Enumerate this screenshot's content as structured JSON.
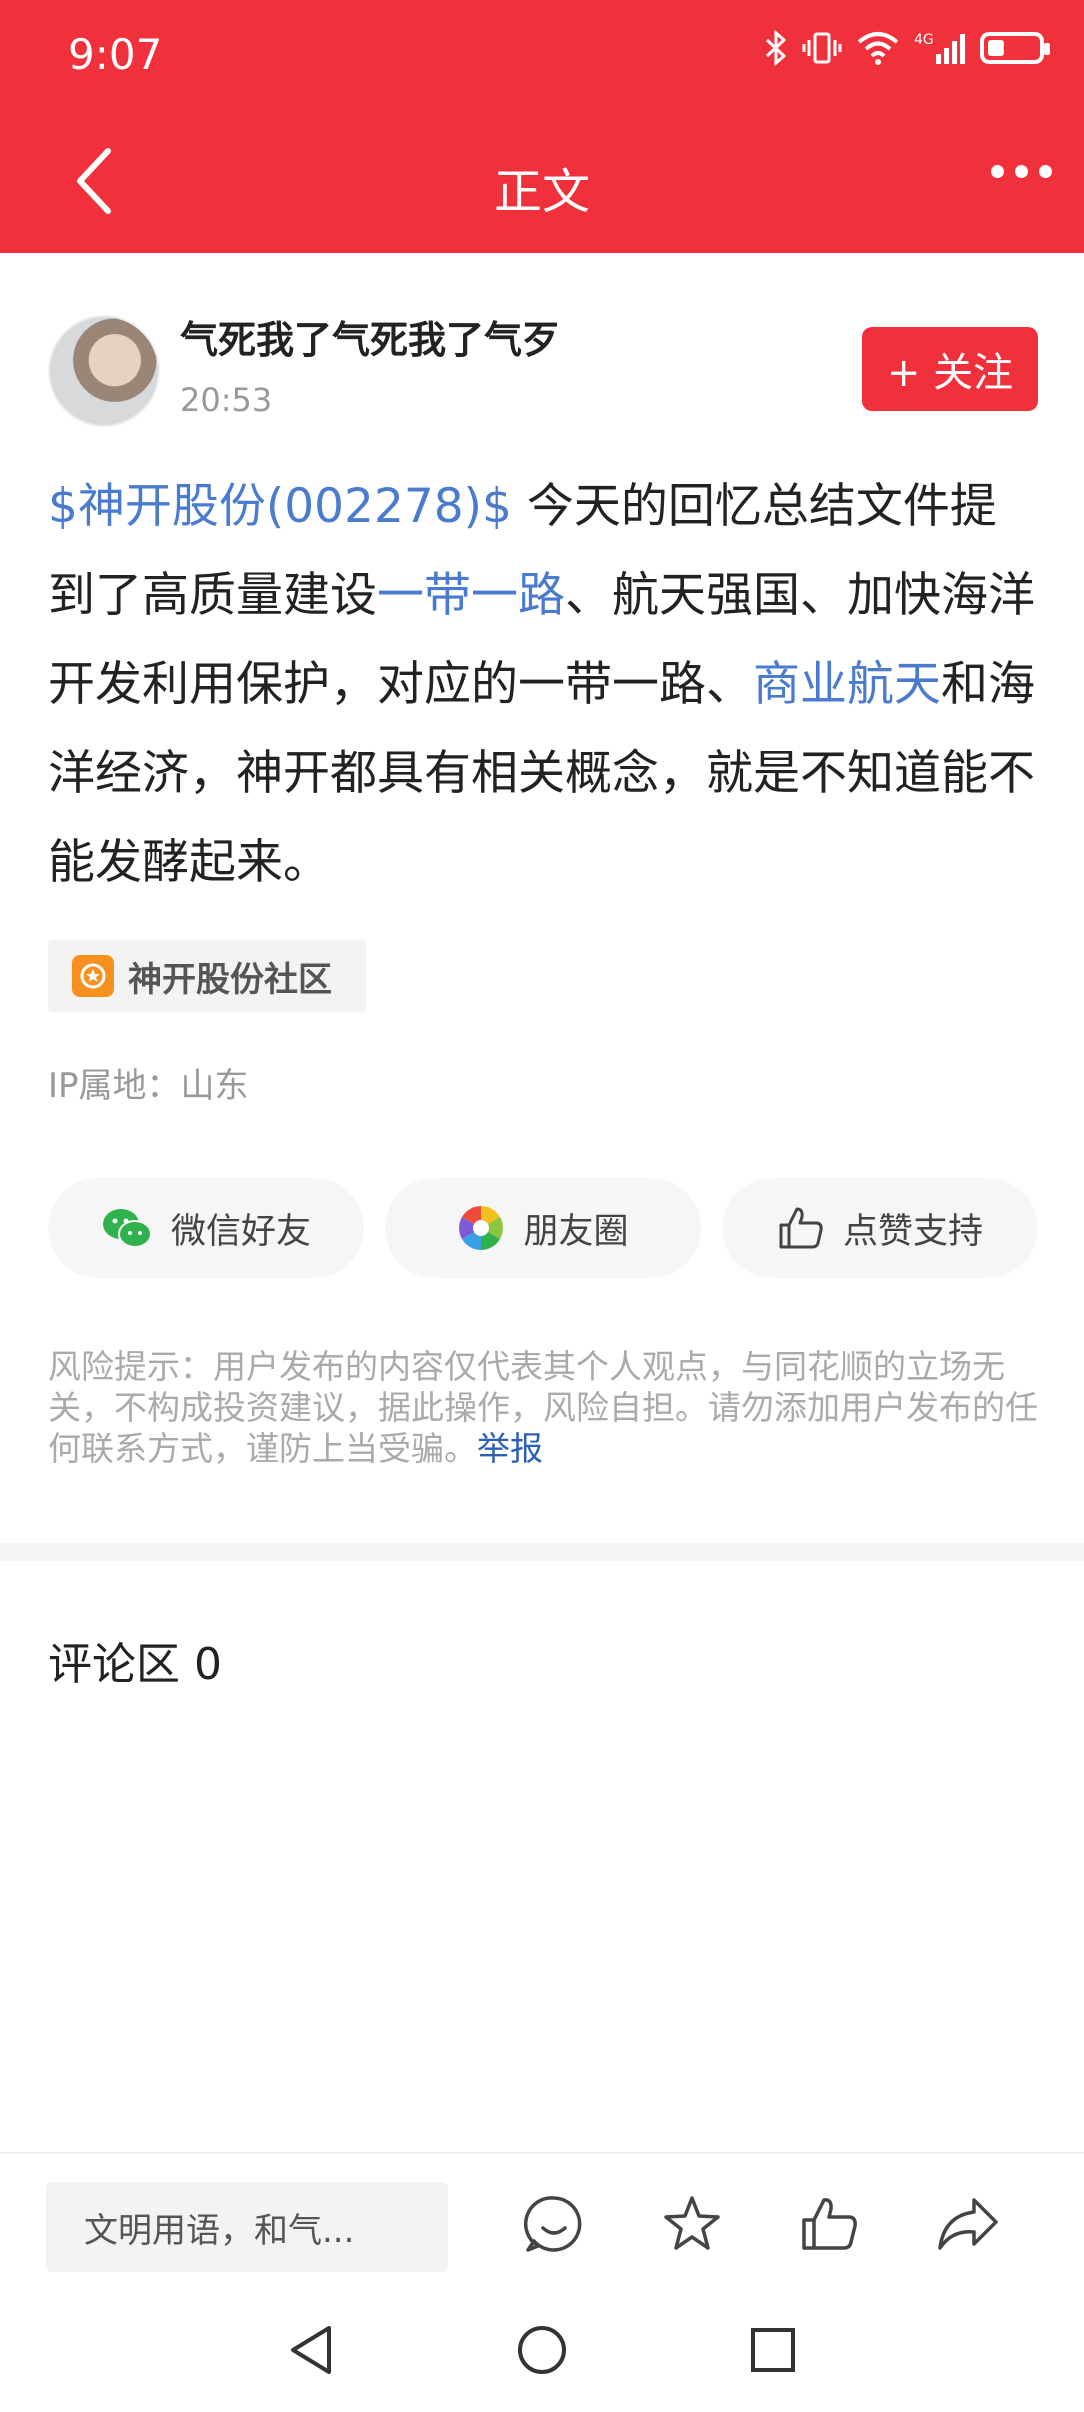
{
  "status_bar": {
    "time": "9:07",
    "network": "4G"
  },
  "header": {
    "title": "正文"
  },
  "author": {
    "name": "气死我了气死我了气歹",
    "time": "20:53",
    "follow_label": "+ 关注"
  },
  "post": {
    "parts": [
      {
        "text": "$神开股份(002278)$",
        "link": true
      },
      {
        "text": " 今天的回忆总结文件提到了高质量建设",
        "link": false
      },
      {
        "text": "一带一路",
        "link": true
      },
      {
        "text": "、航天强国、加快海洋开发利用保护，对应的一带一路、",
        "link": false
      },
      {
        "text": "商业航天",
        "link": true
      },
      {
        "text": "和海洋经济，神开都具有相关概念，就是不知道能不能发酵起来。",
        "link": false
      }
    ]
  },
  "community_tag": {
    "label": "神开股份社区"
  },
  "ip_location": "IP属地：山东",
  "share": {
    "wechat_label": "微信好友",
    "moments_label": "朋友圈",
    "like_label": "点赞支持"
  },
  "disclaimer": {
    "text": "风险提示：用户发布的内容仅代表其个人观点，与同花顺的立场无关，不构成投资建议，据此操作，风险自担。请勿添加用户发布的任何联系方式，谨防上当受骗。",
    "report_label": "举报"
  },
  "comments": {
    "title": "评论区 0"
  },
  "bottom_bar": {
    "input_placeholder": "文明用语，和气..."
  },
  "colors": {
    "brand_red": "#f0303a",
    "link_blue": "#4a7bcf",
    "report_blue": "#2c5fb8"
  }
}
